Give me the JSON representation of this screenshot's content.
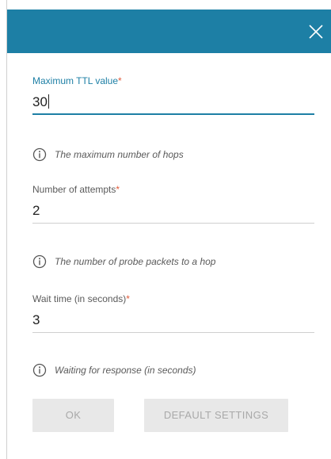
{
  "icons": {
    "close": "close-icon",
    "info": "info-icon"
  },
  "colors": {
    "header": "#1d7fa5",
    "accent": "#1d7fa5",
    "required": "#e05a3a",
    "button_bg": "#e8e8e8",
    "button_text": "#a9a9a9"
  },
  "form": {
    "ttl": {
      "label": "Maximum TTL value",
      "required_mark": "*",
      "value": "30",
      "hint": "The maximum number of hops"
    },
    "attempts": {
      "label": "Number of attempts",
      "required_mark": "*",
      "value": "2",
      "hint": "The number of probe packets to a hop"
    },
    "wait": {
      "label": "Wait time (in seconds)",
      "required_mark": "*",
      "value": "3",
      "hint": "Waiting for response (in seconds)"
    }
  },
  "buttons": {
    "ok": "OK",
    "default": "DEFAULT SETTINGS"
  }
}
